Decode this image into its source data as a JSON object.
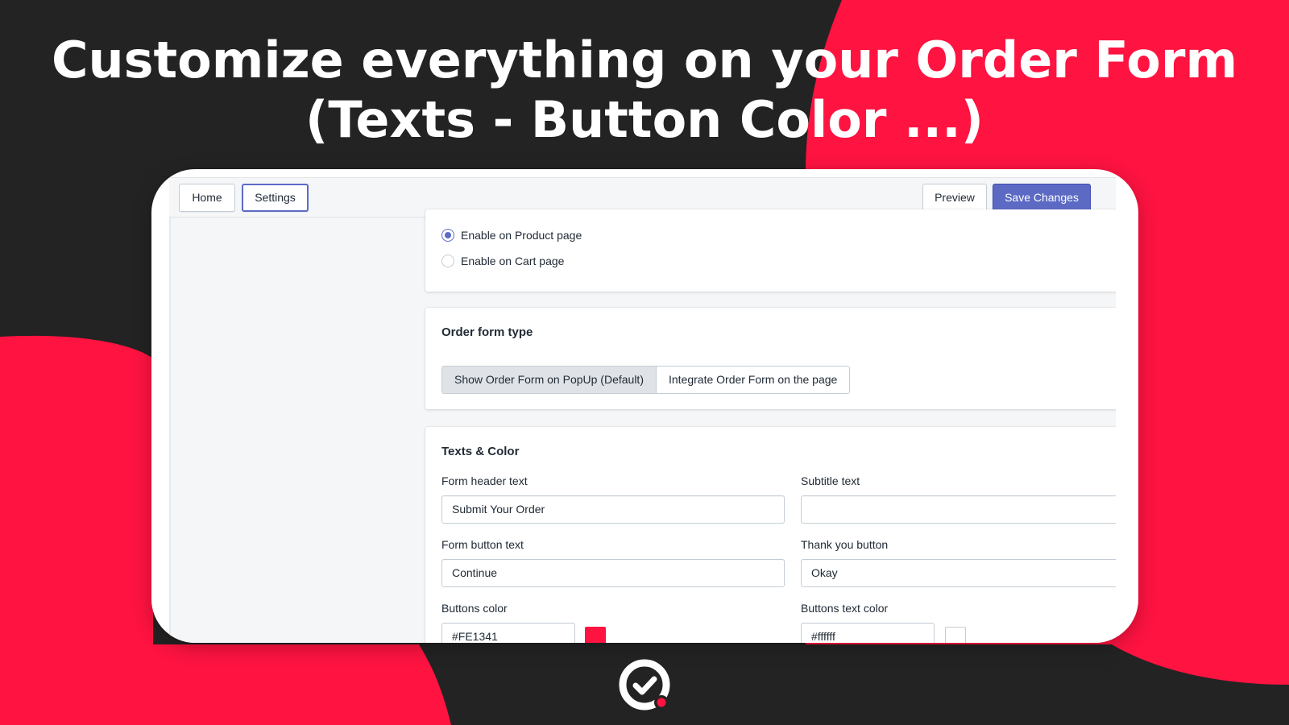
{
  "headline": {
    "line1": "Customize everything on your Order Form",
    "line2": "(Texts - Button Color ...)"
  },
  "colors": {
    "background_dark": "#232323",
    "accent_red": "#FE1341",
    "primary_button": "#5c6ac4"
  },
  "toolbar": {
    "home_label": "Home",
    "settings_label": "Settings",
    "preview_label": "Preview",
    "save_label": "Save Changes"
  },
  "placement": {
    "options": [
      {
        "label": "Enable on Product page",
        "checked": true
      },
      {
        "label": "Enable on Cart page",
        "checked": false
      }
    ]
  },
  "order_form_type": {
    "title": "Order form type",
    "options": [
      {
        "label": "Show Order Form on PopUp (Default)",
        "selected": true
      },
      {
        "label": "Integrate Order Form on the page",
        "selected": false
      }
    ]
  },
  "texts_color": {
    "title": "Texts & Color",
    "form_header": {
      "label": "Form header text",
      "value": "Submit Your Order"
    },
    "subtitle": {
      "label": "Subtitle text",
      "value": ""
    },
    "form_button": {
      "label": "Form button text",
      "value": "Continue"
    },
    "thank_you_button": {
      "label": "Thank you button",
      "value": "Okay"
    },
    "buttons_color": {
      "label": "Buttons color",
      "value": "#FE1341"
    },
    "buttons_text_color": {
      "label": "Buttons text color",
      "value": "#ffffff"
    }
  },
  "logo": {
    "icon": "check-circle-logo-icon"
  }
}
